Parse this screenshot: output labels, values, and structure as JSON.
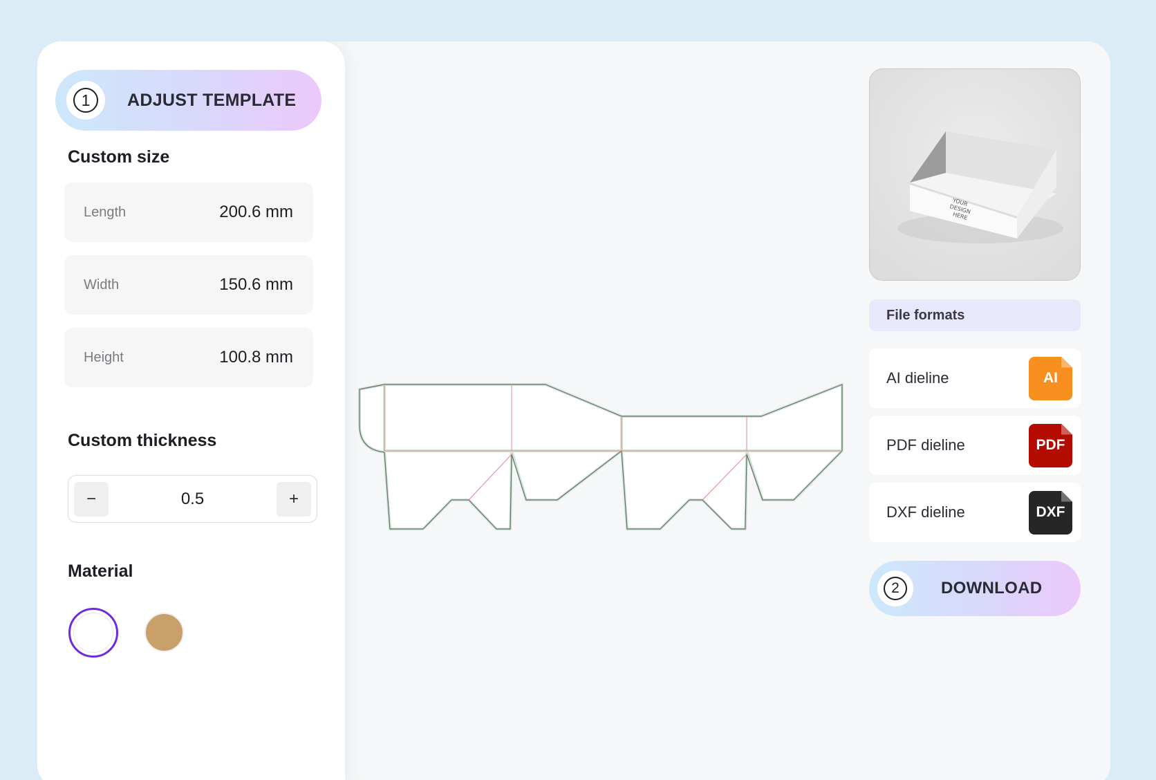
{
  "adjust": {
    "step": "1",
    "label": "ADJUST TEMPLATE"
  },
  "custom_size": {
    "title": "Custom size",
    "fields": [
      {
        "label": "Length",
        "value": "200.6 mm"
      },
      {
        "label": "Width",
        "value": "150.6 mm"
      },
      {
        "label": "Height",
        "value": "100.8 mm"
      }
    ]
  },
  "thickness": {
    "title": "Custom thickness",
    "minus": "−",
    "value": "0.5",
    "plus": "+"
  },
  "material": {
    "title": "Material",
    "swatches": [
      {
        "name": "white",
        "color": "#ffffff",
        "selected": true
      },
      {
        "name": "kraft",
        "color": "#c9a06a",
        "selected": false
      }
    ]
  },
  "preview": {
    "box_text_1": "YOUR",
    "box_text_2": "DESIGN",
    "box_text_3": "HERE"
  },
  "formats": {
    "title": "File formats",
    "items": [
      {
        "label": "AI dieline",
        "icon_text": "AI",
        "color": "#f7901e"
      },
      {
        "label": "PDF dieline",
        "icon_text": "PDF",
        "color": "#b30b00"
      },
      {
        "label": "DXF dieline",
        "icon_text": "DXF",
        "color": "#262626"
      }
    ]
  },
  "download": {
    "step": "2",
    "label": "DOWNLOAD"
  },
  "colors": {
    "accent": "#6e2ae0",
    "cut_line": "#6b6b6b",
    "fold_line": "#e08a8a"
  }
}
